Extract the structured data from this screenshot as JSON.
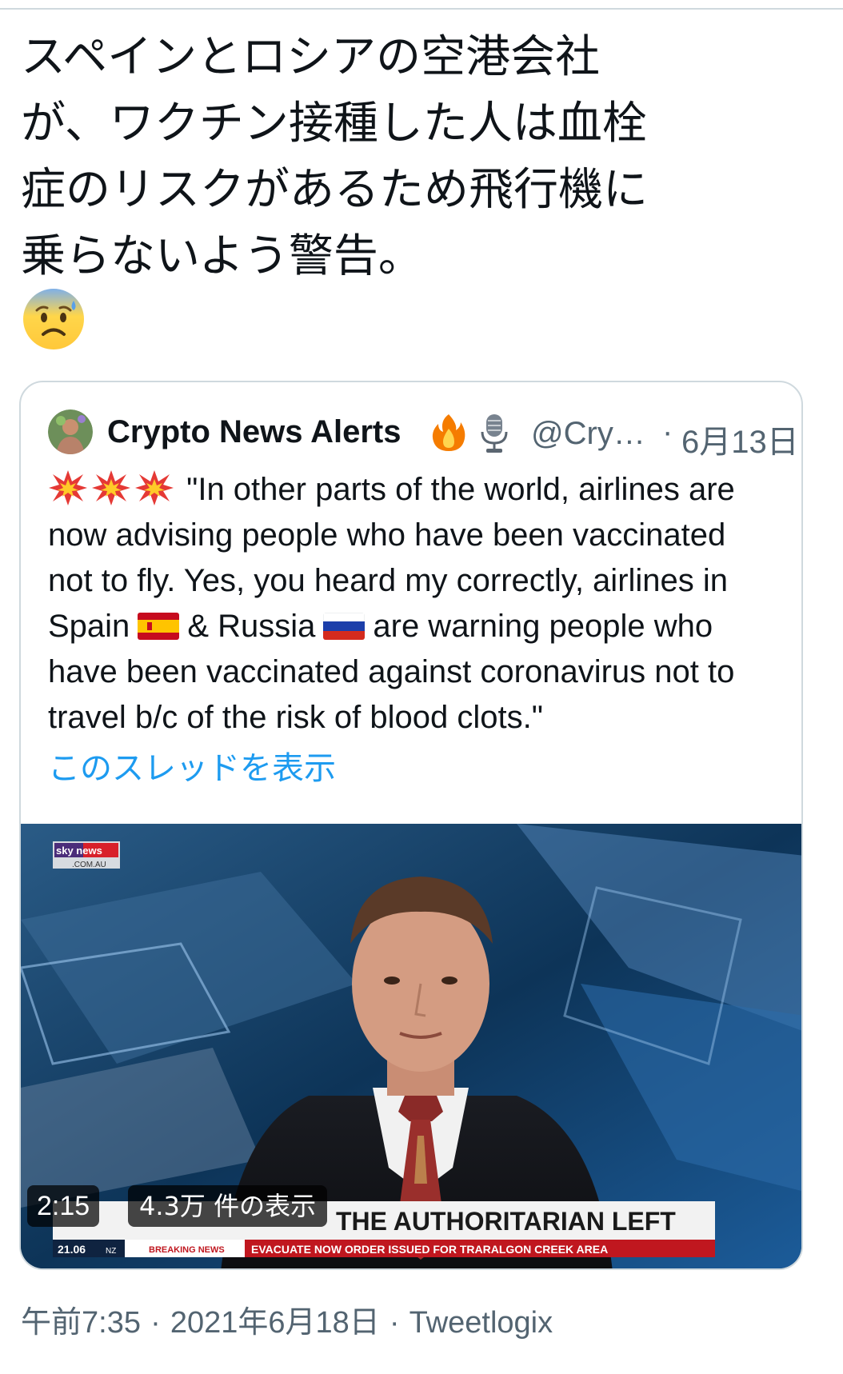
{
  "tweet": {
    "text": "スペインとロシアの空港会社\nが、ワクチン接種した人は血栓\n症のリスクがあるため飛行機に\n乗らないよう警告。",
    "emoji": "anxious-face-with-sweat"
  },
  "quoted": {
    "name": "Crypto News Alerts",
    "badges": [
      "fire-icon",
      "microphone-icon"
    ],
    "handle": "@Cry…",
    "separator": "·",
    "date": "6月13日",
    "body_line1": "\"In other parts of the world, airlines are",
    "body_line2": "now advising people who have been vaccinated",
    "body_line3": "not to fly. Yes, you heard my correctly, airlines in",
    "body_line4_a": "Spain",
    "body_line4_b": "& Russia",
    "body_line4_c": "are warning people who",
    "body_line5": "have been vaccinated against coronavirus not to",
    "body_line6": "travel b/c of the risk of blood clots.\"",
    "show_thread": "このスレッドを表示"
  },
  "video": {
    "duration": "2:15",
    "views": "4.3万 件の表示",
    "channel_logo": "sky news",
    "channel_logo_sub": ".COM.AU",
    "headline": "THE AUTHORITARIAN LEFT",
    "time_bug": "21.06",
    "tz": "NZ",
    "breaking": "BREAKING NEWS",
    "ticker": "EVACUATE NOW ORDER ISSUED FOR TRARALGON CREEK AREA"
  },
  "footer": {
    "time": "午前7:35",
    "sep1": "·",
    "date": "2021年6月18日",
    "sep2": "·",
    "source": "Tweetlogix"
  },
  "colors": {
    "link": "#1d9bf0",
    "muted": "#536471",
    "border": "#cfd9de"
  }
}
